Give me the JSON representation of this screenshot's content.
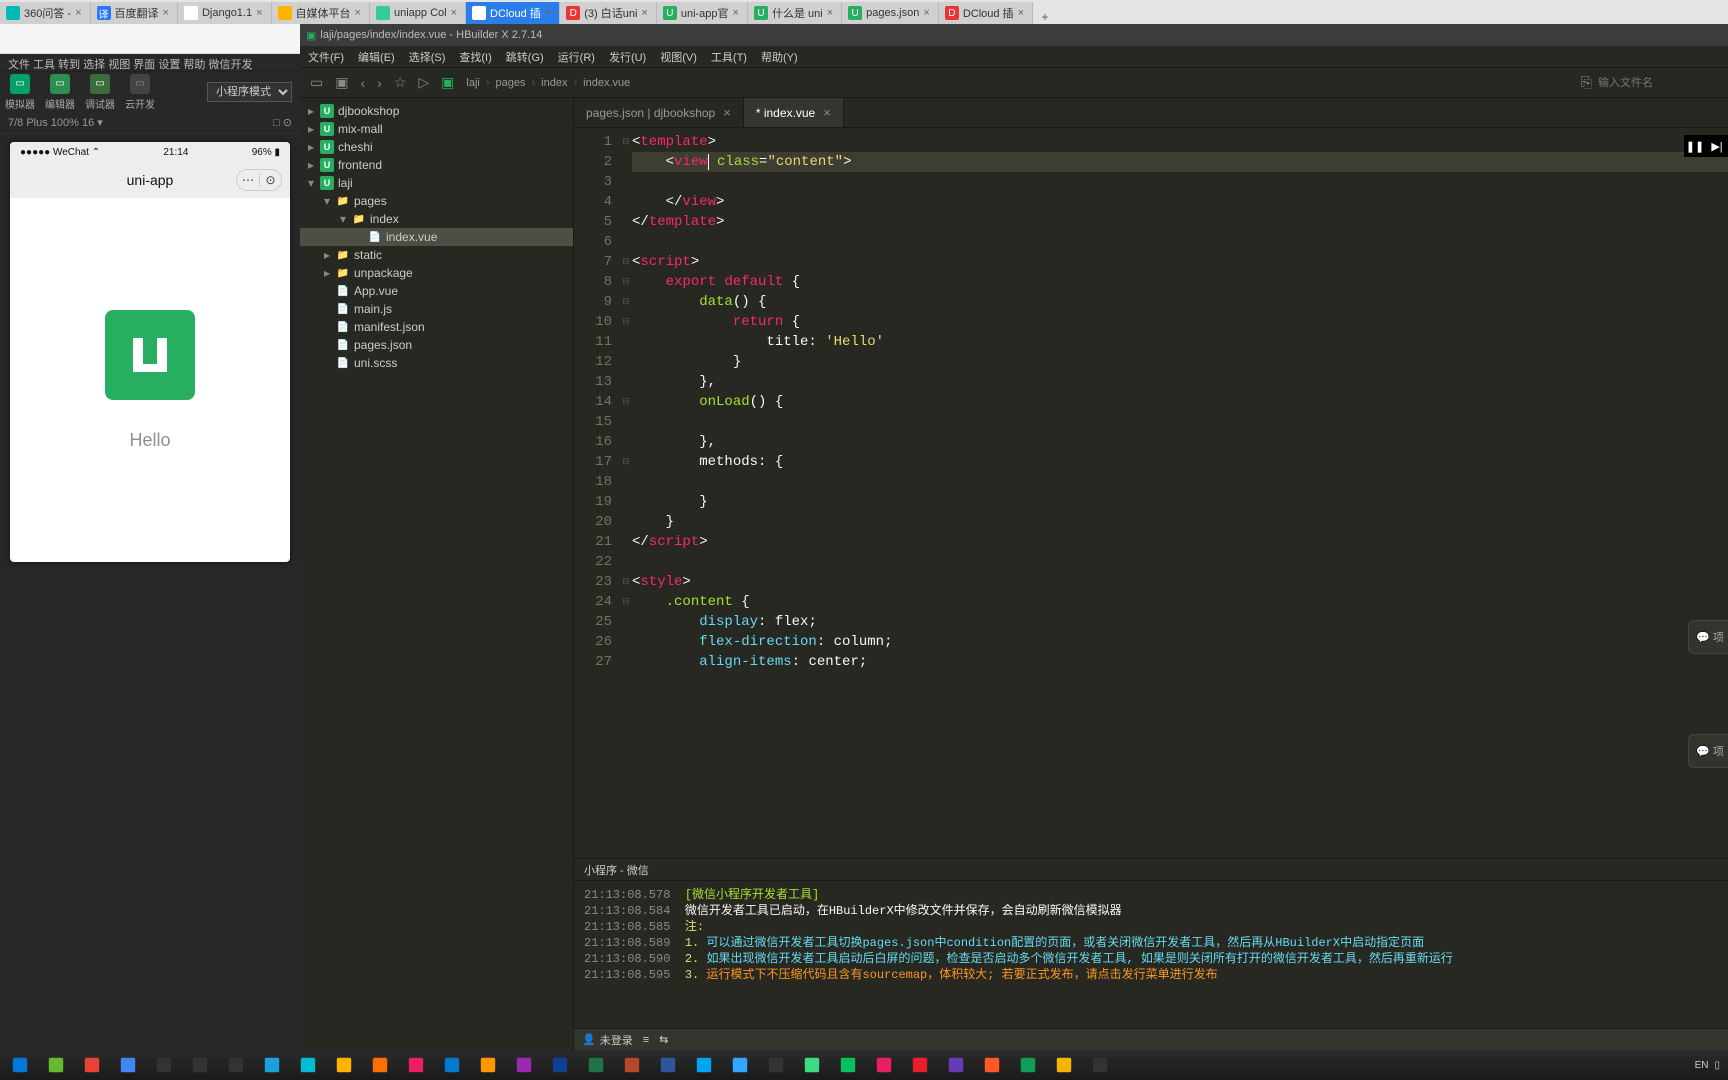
{
  "browser_tabs": [
    {
      "label": "360问答 -",
      "fav": "#0bb",
      "close": true
    },
    {
      "label": "百度翻译",
      "fav": "#2878ff",
      "close": true,
      "icon": "译"
    },
    {
      "label": "Django1.1",
      "fav": "#fff",
      "close": true,
      "text": "dj"
    },
    {
      "label": "自媒体平台",
      "fav": "#ffb300",
      "close": true
    },
    {
      "label": "uniapp Col",
      "fav": "#3c9",
      "close": true
    },
    {
      "label": "DCloud 插",
      "fav": "#fff",
      "close": true,
      "active": true,
      "bg": "#2b7de9"
    },
    {
      "label": "(3) 白话uni",
      "fav": "#e33",
      "close": true,
      "text": "D"
    },
    {
      "label": "uni-app官",
      "fav": "#27ae60",
      "close": true,
      "text": "U"
    },
    {
      "label": "什么是 uni",
      "fav": "#27ae60",
      "close": true,
      "text": "U"
    },
    {
      "label": "pages.json",
      "fav": "#27ae60",
      "close": true,
      "text": "U"
    },
    {
      "label": "DCloud 插",
      "fav": "#e33",
      "close": true,
      "text": "D"
    }
  ],
  "devtools": {
    "menu": "文件 工具 转到 选择 视图 界面 设置 帮助 微信开发",
    "buttons": [
      {
        "label": "模拟器",
        "cls": "g1"
      },
      {
        "label": "编辑器",
        "cls": "g2"
      },
      {
        "label": "调试器",
        "cls": "g3"
      },
      {
        "label": "云开发",
        "cls": "gd"
      }
    ],
    "mode": "小程序模式",
    "status_left": "7/8 Plus 100% 16 ▾",
    "status_icons": "□ ⊙",
    "phone_status_left": "●●●●● WeChat ⌃",
    "phone_time": "21:14",
    "phone_status_right": "96% ▮",
    "phone_title": "uni-app",
    "phone_hello": "Hello"
  },
  "hbuilder": {
    "title": "laji/pages/index/index.vue - HBuilder X 2.7.14",
    "menu": [
      "文件(F)",
      "编辑(E)",
      "选择(S)",
      "查找(I)",
      "跳转(G)",
      "运行(R)",
      "发行(U)",
      "视图(V)",
      "工具(T)",
      "帮助(Y)"
    ],
    "breadcrumb": [
      "laji",
      "pages",
      "index",
      "index.vue"
    ],
    "search_placeholder": "输入文件名",
    "tree": [
      {
        "d": 0,
        "a": "▸",
        "i": "uni",
        "t": "djbookshop"
      },
      {
        "d": 0,
        "a": "▸",
        "i": "uni",
        "t": "mix-mall"
      },
      {
        "d": 0,
        "a": "▸",
        "i": "uni",
        "t": "cheshi"
      },
      {
        "d": 0,
        "a": "▸",
        "i": "uni",
        "t": "frontend"
      },
      {
        "d": 0,
        "a": "▾",
        "i": "uni",
        "t": "laji"
      },
      {
        "d": 1,
        "a": "▾",
        "i": "folder",
        "t": "pages"
      },
      {
        "d": 2,
        "a": "▾",
        "i": "folder",
        "t": "index"
      },
      {
        "d": 3,
        "a": "",
        "i": "file",
        "t": "index.vue",
        "sel": true
      },
      {
        "d": 1,
        "a": "▸",
        "i": "folder",
        "t": "static"
      },
      {
        "d": 1,
        "a": "▸",
        "i": "folder",
        "t": "unpackage"
      },
      {
        "d": 1,
        "a": "",
        "i": "file",
        "t": "App.vue"
      },
      {
        "d": 1,
        "a": "",
        "i": "file",
        "t": "main.js"
      },
      {
        "d": 1,
        "a": "",
        "i": "file",
        "t": "manifest.json"
      },
      {
        "d": 1,
        "a": "",
        "i": "file",
        "t": "pages.json"
      },
      {
        "d": 1,
        "a": "",
        "i": "file",
        "t": "uni.scss"
      }
    ],
    "tabs": [
      {
        "label": "pages.json | djbookshop",
        "active": false
      },
      {
        "label": "* index.vue",
        "active": true
      }
    ],
    "code": [
      {
        "n": 1,
        "f": "⊟",
        "html": "<span class='t-punc'>&lt;</span><span class='t-tag'>template</span><span class='t-punc'>&gt;</span>"
      },
      {
        "n": 2,
        "hl": true,
        "html": "    <span class='t-punc'>&lt;</span><span class='t-tag'>view</span><span class='cursor'></span> <span class='t-attr'>class</span><span class='t-punc'>=</span><span class='t-str'>\"content\"</span><span class='t-punc'>&gt;</span>"
      },
      {
        "n": 3,
        "html": ""
      },
      {
        "n": 4,
        "html": "    <span class='t-punc'>&lt;/</span><span class='t-tag'>view</span><span class='t-punc'>&gt;</span>"
      },
      {
        "n": 5,
        "html": "<span class='t-punc'>&lt;/</span><span class='t-tag'>template</span><span class='t-punc'>&gt;</span>"
      },
      {
        "n": 6,
        "html": ""
      },
      {
        "n": 7,
        "f": "⊟",
        "html": "<span class='t-punc'>&lt;</span><span class='t-tag'>script</span><span class='t-punc'>&gt;</span>"
      },
      {
        "n": 8,
        "f": "⊟",
        "html": "    <span class='t-kw2'>export</span> <span class='t-kw2'>default</span> <span class='t-punc'>{</span>"
      },
      {
        "n": 9,
        "f": "⊟",
        "html": "        <span class='t-name'>data</span><span class='t-punc'>() {</span>"
      },
      {
        "n": 10,
        "f": "⊟",
        "html": "            <span class='t-kw2'>return</span> <span class='t-punc'>{</span>"
      },
      {
        "n": 11,
        "html": "                <span class='t-key'>title:</span> <span class='t-str'>'Hello'</span>"
      },
      {
        "n": 12,
        "html": "            <span class='t-punc'>}</span>"
      },
      {
        "n": 13,
        "html": "        <span class='t-punc'>},</span>"
      },
      {
        "n": 14,
        "f": "⊟",
        "html": "        <span class='t-name'>onLoad</span><span class='t-punc'>() {</span>"
      },
      {
        "n": 15,
        "html": ""
      },
      {
        "n": 16,
        "html": "        <span class='t-punc'>},</span>"
      },
      {
        "n": 17,
        "f": "⊟",
        "html": "        <span class='t-key'>methods:</span> <span class='t-punc'>{</span>"
      },
      {
        "n": 18,
        "html": ""
      },
      {
        "n": 19,
        "html": "        <span class='t-punc'>}</span>"
      },
      {
        "n": 20,
        "html": "    <span class='t-punc'>}</span>"
      },
      {
        "n": 21,
        "html": "<span class='t-punc'>&lt;/</span><span class='t-tag'>script</span><span class='t-punc'>&gt;</span>"
      },
      {
        "n": 22,
        "html": ""
      },
      {
        "n": 23,
        "f": "⊟",
        "html": "<span class='t-punc'>&lt;</span><span class='t-tag'>style</span><span class='t-punc'>&gt;</span>"
      },
      {
        "n": 24,
        "f": "⊟",
        "html": "    <span class='t-sel'>.content</span> <span class='t-punc'>{</span>"
      },
      {
        "n": 25,
        "html": "        <span class='t-prop'>display</span><span class='t-punc'>:</span> <span class='t-key'>flex</span><span class='t-punc'>;</span>"
      },
      {
        "n": 26,
        "html": "        <span class='t-prop'>flex-direction</span><span class='t-punc'>:</span> <span class='t-key'>column</span><span class='t-punc'>;</span>"
      },
      {
        "n": 27,
        "html": "        <span class='t-prop'>align-items</span><span class='t-punc'>:</span> <span class='t-key'>center</span><span class='t-punc'>;</span>"
      }
    ],
    "console_tab": "小程序 - 微信",
    "console": [
      {
        "ts": "21:13:08.578",
        "html": "<span class='c-green'>[微信小程序开发者工具]</span>"
      },
      {
        "ts": "21:13:08.584",
        "html": "<span class='t-key'>微信开发者工具已启动，在HBuilderX中修改文件并保存，会自动刷新微信模拟器</span>"
      },
      {
        "ts": "21:13:08.585",
        "html": "<span class='c-yellow'>注:</span>"
      },
      {
        "ts": "21:13:08.589",
        "html": "<span class='c-yellow'>1. </span><span class='c-blue'>可以通过微信开发者工具切换pages.json中condition配置的页面，或者关闭微信开发者工具，然后再从HBuilderX中启动指定页面</span>"
      },
      {
        "ts": "21:13:08.590",
        "html": "<span class='c-yellow'>2. </span><span class='c-blue'>如果出现微信开发者工具启动后白屏的问题，检查是否启动多个微信开发者工具, 如果是则关闭所有打开的微信开发者工具，然后再重新运行</span>"
      },
      {
        "ts": "21:13:08.595",
        "html": "<span class='c-yellow'>3. </span><span class='c-orange'>运行模式下不压缩代码且含有sourcemap，体积较大; 若要正式发布，请点击发行菜单进行发布</span>"
      }
    ],
    "status_user": "未登录",
    "float_label": "项"
  },
  "taskbar": {
    "tray": "EN"
  }
}
